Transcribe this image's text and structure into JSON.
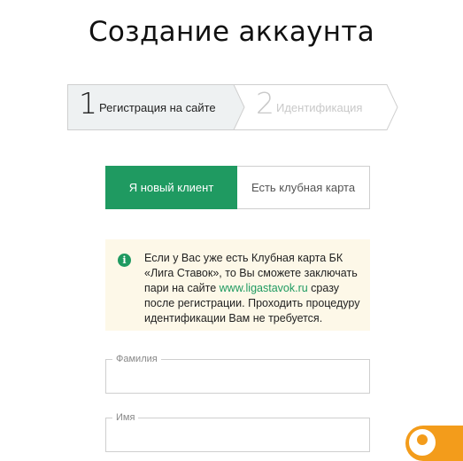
{
  "page": {
    "title": "Создание аккаунта"
  },
  "steps": [
    {
      "number": "1",
      "label": "Регистрация на сайте",
      "state": "active"
    },
    {
      "number": "2",
      "label": "Идентификация",
      "state": "inactive"
    }
  ],
  "client_toggle": {
    "new_client": "Я новый клиент",
    "club_card": "Есть клубная карта",
    "selected": "new_client"
  },
  "notice": {
    "icon": "info-icon",
    "text_before": "Если у Вас уже есть Клубная карта БК «Лига Ставок», то Вы сможете заключать пари на сайте ",
    "link_text": "www.ligastavok.ru",
    "text_after": " сразу после регистрации. Проходить процедуру идентификации Вам не требуется."
  },
  "form": {
    "surname_label": "Фамилия",
    "surname_value": "",
    "name_label": "Имя",
    "name_value": ""
  },
  "colors": {
    "accent_green": "#1f9a61",
    "notice_bg": "#fdf8e8",
    "chat_orange": "#f39c1b"
  },
  "chat": {
    "icon": "chat-user-icon"
  }
}
